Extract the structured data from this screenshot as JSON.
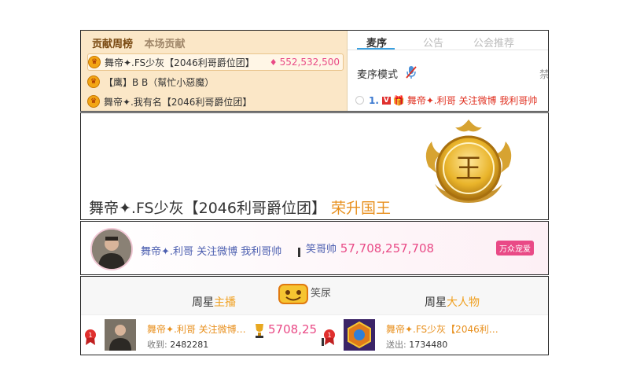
{
  "contribution": {
    "tabs": [
      "贡献周榜",
      "本场贡献"
    ],
    "rows": [
      {
        "rank_icon": "crown-icon",
        "name": "舞帝✦.FS少灰【2046利哥爵位团】",
        "amount": "552,532,500"
      },
      {
        "rank_icon": "crown-icon",
        "name": "【鹰】B B（幫忙小惡魔）",
        "amount": ""
      },
      {
        "rank_icon": "crown-icon",
        "name": "舞帝✦.我有名【2046利哥爵位团】",
        "amount": ""
      }
    ]
  },
  "mic": {
    "tabs": [
      "麦序",
      "公告",
      "公会推荐"
    ],
    "mode_label": "麦序模式",
    "right_label": "禁",
    "item": {
      "num": "1.",
      "vip": "V",
      "name": "舞帝✦.利哥  关注微博 我利哥帅"
    }
  },
  "announcement": {
    "user": "舞帝✦.FS少灰【2046利哥爵位团】",
    "title": "荣升国王",
    "badge_char": "王"
  },
  "banner": {
    "text": "舞帝✦.利哥  关注微博 我利哥帅",
    "right_name": "笑哥帅",
    "right_value": "57,708,257,708",
    "badge": "万众宠爱"
  },
  "weekly": {
    "left_title_pre": "周星",
    "left_title_hl": "主播",
    "right_title_pre": "周星",
    "right_title_hl": "大人物",
    "center_label": "笑尿",
    "left_card": {
      "rank": "1",
      "name": "舞帝✦.利哥  关注微博…",
      "stat_label": "收到:",
      "stat_value": "2482281"
    },
    "right_card": {
      "rank": "1",
      "name": "舞帝✦.FS少灰【2046利…",
      "stat_label": "送出:",
      "stat_value": "1734480"
    },
    "middle_value": "5708,25"
  },
  "colors": {
    "accent_pink": "#e94a86",
    "accent_orange": "#e8901e",
    "link_blue": "#4c5fb0"
  }
}
